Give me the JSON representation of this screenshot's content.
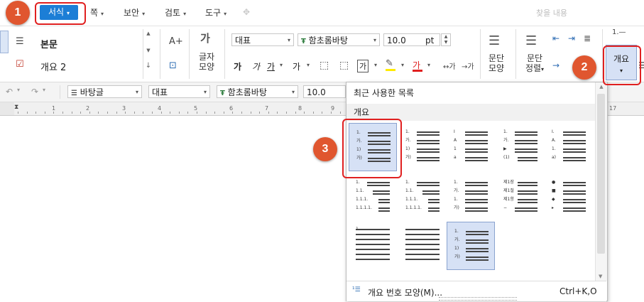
{
  "menubar": {
    "items": [
      {
        "label": "서식",
        "active": true
      },
      {
        "label": "쪽"
      },
      {
        "label": "보안"
      },
      {
        "label": "검토"
      },
      {
        "label": "도구"
      }
    ],
    "search_placeholder": "찾을 내용"
  },
  "ribbon": {
    "styles": [
      "본문",
      "개요 2"
    ],
    "char_shape_label": [
      "글자",
      "모양"
    ],
    "style_name": "대표",
    "font_name": "함초롬바탕",
    "font_size": "10.0",
    "font_unit": "pt",
    "para_shape_label": [
      "문단",
      "모양"
    ],
    "para_align_label": [
      "문단",
      "정렬"
    ],
    "outline_button": "개요"
  },
  "toolbar2": {
    "style": "바탕글",
    "lang": "대표",
    "font": "함초롬바탕",
    "size": "10.0"
  },
  "ruler": {
    "numbers": [
      "1",
      "2",
      "3",
      "4",
      "5",
      "6",
      "7",
      "8",
      "9",
      "17"
    ]
  },
  "dropdown": {
    "section_recent": "최근 사용한 목록",
    "section_outline": "개요",
    "footer_label": "개요 번호 모양(M)...",
    "footer_shortcut": "Ctrl+K,O"
  },
  "tiles": [
    {
      "id": "t1",
      "labels": [
        "1.",
        "가.",
        "1)",
        "가)"
      ],
      "selected": true
    },
    {
      "id": "t2",
      "labels": [
        "1.",
        "가.",
        "1)",
        "가)"
      ]
    },
    {
      "id": "t3",
      "labels": [
        "I",
        "A",
        "1",
        "a"
      ]
    },
    {
      "id": "t4",
      "labels": [
        "1.",
        "가.",
        "▶",
        "(1)"
      ]
    },
    {
      "id": "t5",
      "labels": [
        "I.",
        "A.",
        "1.",
        "a)"
      ]
    },
    {
      "id": "t6",
      "labels": [
        "1.",
        "1.1.",
        "1.1.1.",
        "1.1.1.1."
      ]
    },
    {
      "id": "t7",
      "labels": [
        "1.",
        "1.1.",
        "1.1.1.",
        "1.1.1.1."
      ]
    },
    {
      "id": "t8",
      "labels": [
        "1.",
        "가.",
        "1.",
        "가)"
      ]
    },
    {
      "id": "t9",
      "labels": [
        "제1장",
        "제1절",
        "제1항",
        "−"
      ]
    },
    {
      "id": "t10",
      "labels": [
        "●",
        "■",
        "◆",
        "▸"
      ]
    },
    {
      "id": "t11",
      "labels": [
        "1.",
        "",
        "",
        ""
      ]
    },
    {
      "id": "t12",
      "labels": [
        "",
        "",
        "",
        ""
      ]
    },
    {
      "id": "t13",
      "labels": [
        "1.",
        "가.",
        "1)",
        "가)"
      ],
      "selected": true
    }
  ],
  "badges": [
    "1",
    "2",
    "3"
  ],
  "colors": {
    "accent": "#1c7ed6",
    "badge": "#e0562f",
    "highlight": "#ffeb00",
    "font_color": "#e02020"
  }
}
